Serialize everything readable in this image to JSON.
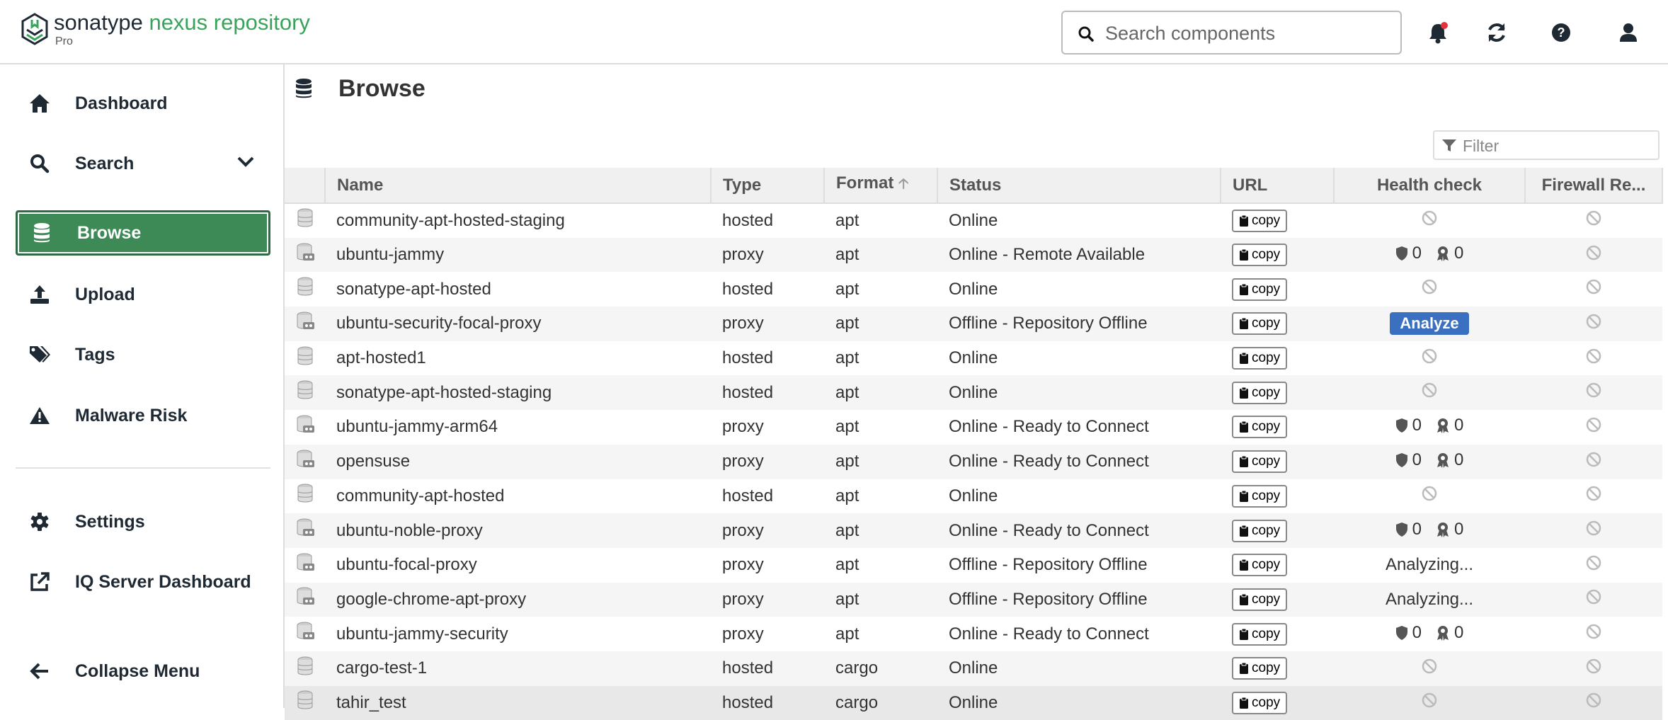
{
  "header": {
    "brand_main": "sonatype",
    "brand_product": "nexus repository",
    "edition": "Pro",
    "search_placeholder": "Search components"
  },
  "sidebar": {
    "items": [
      {
        "label": "Dashboard",
        "icon": "home-icon"
      },
      {
        "label": "Search",
        "icon": "search-icon"
      },
      {
        "label": "Browse",
        "icon": "database-icon"
      },
      {
        "label": "Upload",
        "icon": "upload-icon"
      },
      {
        "label": "Tags",
        "icon": "tags-icon"
      },
      {
        "label": "Malware Risk",
        "icon": "warning-icon"
      },
      {
        "label": "Settings",
        "icon": "gear-icon"
      },
      {
        "label": "IQ Server Dashboard",
        "icon": "external-link-icon"
      },
      {
        "label": "Collapse Menu",
        "icon": "arrow-left-icon"
      }
    ]
  },
  "main": {
    "title": "Browse",
    "filter_placeholder": "Filter",
    "columns": [
      "Name",
      "Type",
      "Format",
      "Status",
      "URL",
      "Health check",
      "Firewall Re..."
    ],
    "copy_label": "copy",
    "analyze_label": "Analyze",
    "rows": [
      {
        "name": "community-apt-hosted-staging",
        "type": "hosted",
        "format": "apt",
        "status": "Online",
        "health": "none"
      },
      {
        "name": "ubuntu-jammy",
        "type": "proxy",
        "format": "apt",
        "status": "Online - Remote Available",
        "health": "counts",
        "sec": "0",
        "lic": "0"
      },
      {
        "name": "sonatype-apt-hosted",
        "type": "hosted",
        "format": "apt",
        "status": "Online",
        "health": "none"
      },
      {
        "name": "ubuntu-security-focal-proxy",
        "type": "proxy",
        "format": "apt",
        "status": "Offline - Repository Offline",
        "health": "analyze"
      },
      {
        "name": "apt-hosted1",
        "type": "hosted",
        "format": "apt",
        "status": "Online",
        "health": "none"
      },
      {
        "name": "sonatype-apt-hosted-staging",
        "type": "hosted",
        "format": "apt",
        "status": "Online",
        "health": "none"
      },
      {
        "name": "ubuntu-jammy-arm64",
        "type": "proxy",
        "format": "apt",
        "status": "Online - Ready to Connect",
        "health": "counts",
        "sec": "0",
        "lic": "0"
      },
      {
        "name": "opensuse",
        "type": "proxy",
        "format": "apt",
        "status": "Online - Ready to Connect",
        "health": "counts",
        "sec": "0",
        "lic": "0"
      },
      {
        "name": "community-apt-hosted",
        "type": "hosted",
        "format": "apt",
        "status": "Online",
        "health": "none"
      },
      {
        "name": "ubuntu-noble-proxy",
        "type": "proxy",
        "format": "apt",
        "status": "Online - Ready to Connect",
        "health": "counts",
        "sec": "0",
        "lic": "0"
      },
      {
        "name": "ubuntu-focal-proxy",
        "type": "proxy",
        "format": "apt",
        "status": "Offline - Repository Offline",
        "health": "text",
        "health_text": "Analyzing..."
      },
      {
        "name": "google-chrome-apt-proxy",
        "type": "proxy",
        "format": "apt",
        "status": "Offline - Repository Offline",
        "health": "text",
        "health_text": "Analyzing..."
      },
      {
        "name": "ubuntu-jammy-security",
        "type": "proxy",
        "format": "apt",
        "status": "Online - Ready to Connect",
        "health": "counts",
        "sec": "0",
        "lic": "0"
      },
      {
        "name": "cargo-test-1",
        "type": "hosted",
        "format": "cargo",
        "status": "Online",
        "health": "none"
      },
      {
        "name": "tahir_test",
        "type": "hosted",
        "format": "cargo",
        "status": "Online",
        "health": "none"
      }
    ]
  },
  "colors": {
    "accent": "#3e8a57",
    "brand_green": "#3aa35b",
    "analyze_blue": "#3b6fbf"
  }
}
